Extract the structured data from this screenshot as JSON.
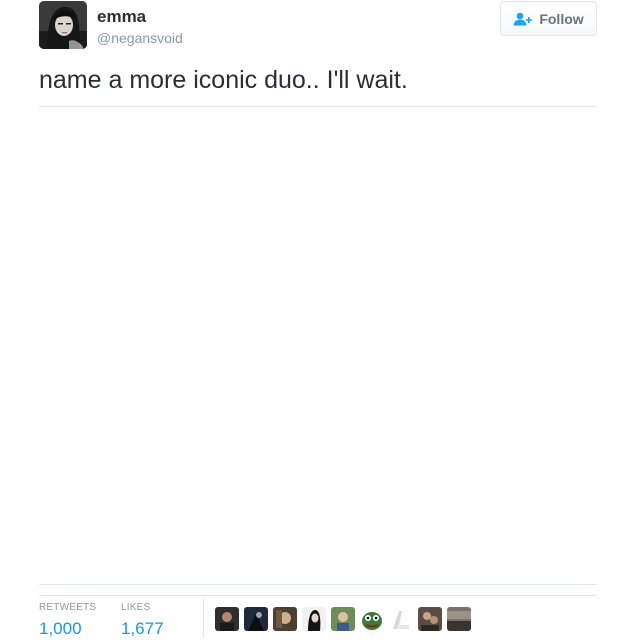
{
  "user": {
    "display_name": "emma",
    "handle": "@negansvoid"
  },
  "follow_button": {
    "label": "Follow",
    "icon": "add-user-icon"
  },
  "tweet": {
    "text": "name a more iconic duo.. I'll wait."
  },
  "stats": {
    "retweets_label": "RETWEETS",
    "retweets_value": "1,000",
    "likes_label": "LIKES",
    "likes_value": "1,677"
  },
  "likers": [
    {
      "icon": "liker-avatar-1"
    },
    {
      "icon": "liker-avatar-2"
    },
    {
      "icon": "liker-avatar-3"
    },
    {
      "icon": "liker-avatar-4"
    },
    {
      "icon": "liker-avatar-5"
    },
    {
      "icon": "liker-avatar-6"
    },
    {
      "icon": "liker-avatar-7"
    },
    {
      "icon": "liker-avatar-8"
    },
    {
      "icon": "liker-avatar-9"
    }
  ],
  "colors": {
    "accent": "#1b95e0",
    "muted": "#8899a6",
    "text": "#292f33",
    "border": "#e1e8ed"
  }
}
